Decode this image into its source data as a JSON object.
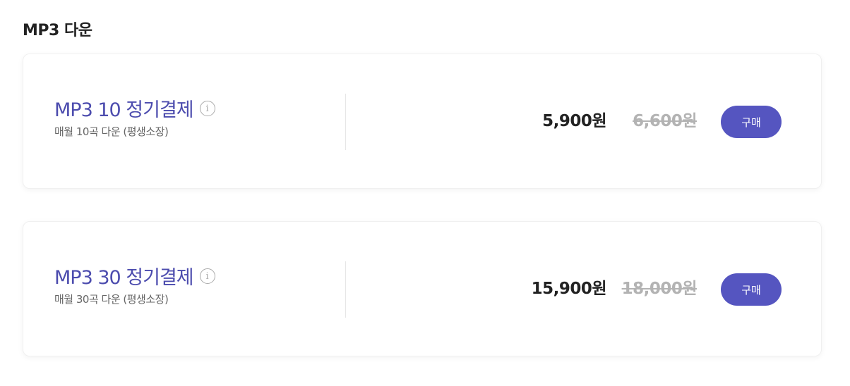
{
  "section": {
    "title": "MP3 다운"
  },
  "plans": [
    {
      "title": "MP3 10 정기결제",
      "info_icon": "info-circle-icon",
      "subtitle": "매월 10곡 다운 (평생소장)",
      "price": "5,900원",
      "original_price": "6,600원",
      "buy_label": "구매"
    },
    {
      "title": "MP3 30 정기결제",
      "info_icon": "info-circle-icon",
      "subtitle": "매월 30곡 다운 (평생소장)",
      "price": "15,900원",
      "original_price": "18,000원",
      "buy_label": "구매"
    }
  ],
  "colors": {
    "accent": "#5555c0",
    "title": "#4c4cae",
    "strike": "#b3b3b3"
  }
}
